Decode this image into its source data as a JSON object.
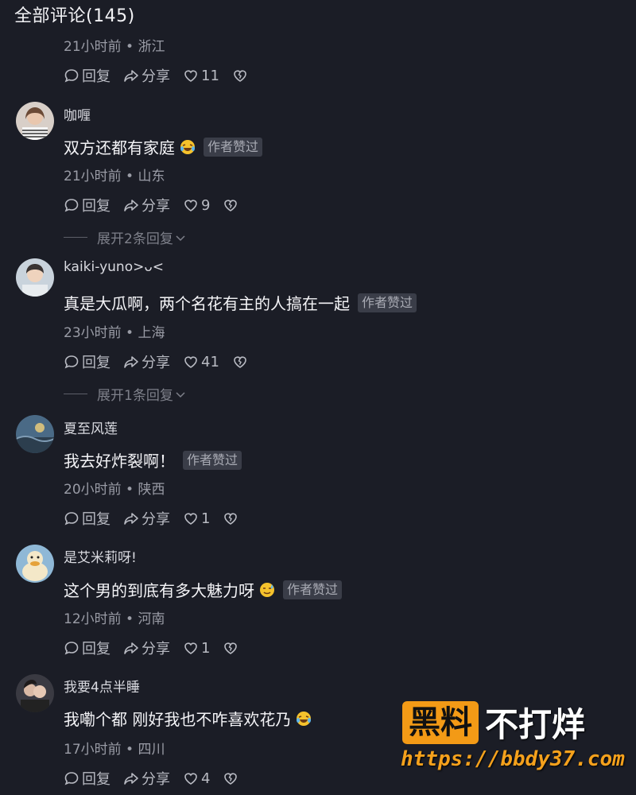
{
  "header": {
    "title": "全部评论(145)"
  },
  "first_partial": {
    "meta": "21小时前 • 浙江",
    "reply": "回复",
    "share": "分享",
    "likes": "11"
  },
  "comments": [
    {
      "username": "咖喱",
      "content": "双方还都有家庭",
      "emoji": "laugh-cry-emoji",
      "badge": "作者赞过",
      "meta": "21小时前 • 山东",
      "reply": "回复",
      "share": "分享",
      "likes": "9",
      "expand": "展开2条回复"
    },
    {
      "username": "kaiki-yuno>ᴗ<",
      "content": "真是大瓜啊，两个名花有主的人搞在一起",
      "badge": "作者赞过",
      "meta": "23小时前 • 上海",
      "reply": "回复",
      "share": "分享",
      "likes": "41",
      "expand": "展开1条回复"
    },
    {
      "username": "夏至风莲",
      "content": "我去好炸裂啊！",
      "badge": "作者赞过",
      "meta": "20小时前 • 陕西",
      "reply": "回复",
      "share": "分享",
      "likes": "1"
    },
    {
      "username": "是艾米莉呀!",
      "content": "这个男的到底有多大魅力呀",
      "emoji": "sweat-emoji",
      "badge": "作者赞过",
      "meta": "12小时前 • 河南",
      "reply": "回复",
      "share": "分享",
      "likes": "1"
    },
    {
      "username": "我要4点半睡",
      "content": "我嘞个都 刚好我也不咋喜欢花乃",
      "emoji": "laugh-cry-emoji",
      "meta": "17小时前 • 四川",
      "reply": "回复",
      "share": "分享",
      "likes": "4"
    }
  ],
  "watermark": {
    "brand": "黑料",
    "slogan": "不打烊",
    "url": "https://bbdy37.com"
  },
  "colors": {
    "background": "#1b1d26",
    "badge_bg": "#3a3d48",
    "watermark_orange": "#f39a16"
  }
}
